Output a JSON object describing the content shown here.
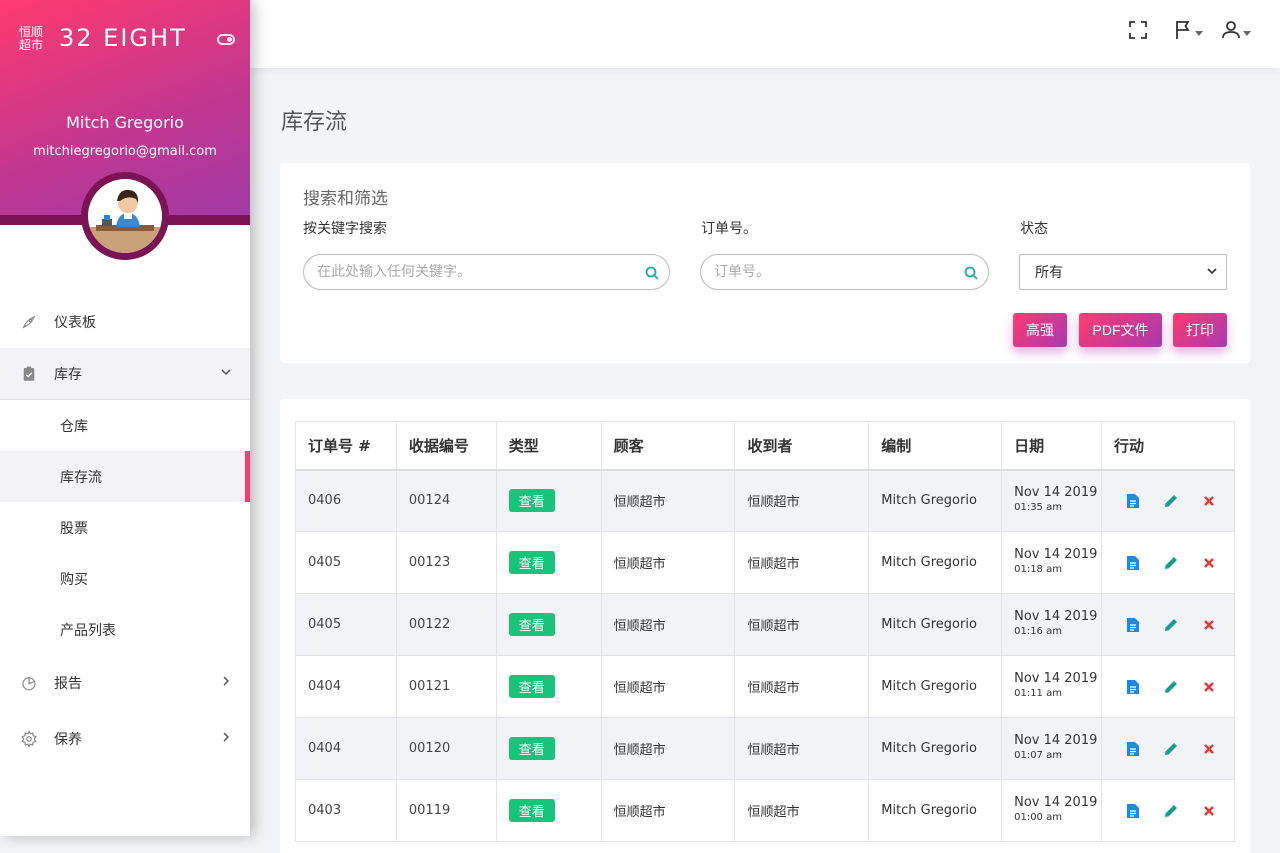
{
  "sidebar": {
    "logo_line1": "恒顺",
    "logo_line2": "超市",
    "brand": "32 EIGHT",
    "user_name": "Mitch Gregorio",
    "user_email": "mitchiegregorio@gmail.com",
    "nav": {
      "dashboard": "仪表板",
      "inventory": "库存",
      "warehouse": "仓库",
      "stock_flow": "库存流",
      "stocks": "股票",
      "purchase": "购买",
      "product_list": "产品列表",
      "reports": "报告",
      "maintenance": "保养"
    }
  },
  "page_title": "库存流",
  "filters": {
    "title": "搜索和筛选",
    "keyword_label": "按关键字搜索",
    "keyword_placeholder": "在此处输入任何关键字。",
    "order_label": "订单号。",
    "order_placeholder": "订单号。",
    "status_label": "状态",
    "status_value": "所有",
    "btn_excel": "高强",
    "btn_pdf": "PDF文件",
    "btn_print": "打印"
  },
  "table": {
    "headers": [
      "订单号 #",
      "收据编号",
      "类型",
      "顾客",
      "收到者",
      "编制",
      "日期",
      "行动"
    ],
    "rows": [
      {
        "order": "0406",
        "receipt": "00124",
        "type": "查看",
        "customer": "恒顺超市",
        "receiver": "恒顺超市",
        "prepared": "Mitch Gregorio",
        "date": "Nov 14 2019",
        "time": "01:35 am"
      },
      {
        "order": "0405",
        "receipt": "00123",
        "type": "查看",
        "customer": "恒顺超市",
        "receiver": "恒顺超市",
        "prepared": "Mitch Gregorio",
        "date": "Nov 14 2019",
        "time": "01:18 am"
      },
      {
        "order": "0405",
        "receipt": "00122",
        "type": "查看",
        "customer": "恒顺超市",
        "receiver": "恒顺超市",
        "prepared": "Mitch Gregorio",
        "date": "Nov 14 2019",
        "time": "01:16 am"
      },
      {
        "order": "0404",
        "receipt": "00121",
        "type": "查看",
        "customer": "恒顺超市",
        "receiver": "恒顺超市",
        "prepared": "Mitch Gregorio",
        "date": "Nov 14 2019",
        "time": "01:11 am"
      },
      {
        "order": "0404",
        "receipt": "00120",
        "type": "查看",
        "customer": "恒顺超市",
        "receiver": "恒顺超市",
        "prepared": "Mitch Gregorio",
        "date": "Nov 14 2019",
        "time": "01:07 am"
      },
      {
        "order": "0403",
        "receipt": "00119",
        "type": "查看",
        "customer": "恒顺超市",
        "receiver": "恒顺超市",
        "prepared": "Mitch Gregorio",
        "date": "Nov 14 2019",
        "time": "01:00 am"
      }
    ]
  },
  "colors": {
    "accent_pink": "#ff3a6e",
    "accent_purple": "#a83ab0",
    "badge_green": "#18c37a",
    "view_icon_blue": "#1e88e5",
    "edit_icon_teal": "#1a9c8c",
    "delete_icon_red": "#e53935"
  },
  "icons": {
    "fullscreen": "fullscreen-icon",
    "flag": "flag-icon",
    "user": "user-icon",
    "dashboard": "rocket-icon",
    "inventory": "clipboard-check-icon",
    "reports": "pie-chart-icon",
    "maintenance": "gear-icon",
    "view": "document-icon",
    "edit": "pencil-icon",
    "delete": "close-icon"
  }
}
